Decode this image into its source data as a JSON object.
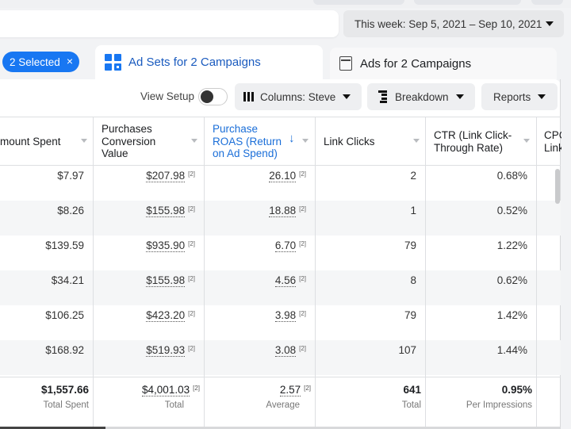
{
  "date_range": {
    "label": "This week: Sep 5, 2021 – Sep 10, 2021"
  },
  "selection": {
    "label": "2 Selected",
    "clear_icon": "×"
  },
  "tabs": [
    {
      "label": "Ad Sets for 2 Campaigns",
      "icon": "ad-sets-grid-icon",
      "active": true
    },
    {
      "label": "Ads for 2 Campaigns",
      "icon": "ad-window-icon",
      "active": false
    }
  ],
  "toolbar": {
    "view_setup_label": "View Setup",
    "view_setup_on": false,
    "columns_label": "Columns: Steve",
    "breakdown_label": "Breakdown",
    "reports_label": "Reports"
  },
  "table": {
    "columns": [
      {
        "label": "mount Spent",
        "full": "Amount Spent"
      },
      {
        "label": "Purchases Conversion Value"
      },
      {
        "label": "Purchase ROAS (Return on Ad Spend)",
        "sorted": "descending"
      },
      {
        "label": "Link Clicks"
      },
      {
        "label": "CTR (Link Click-Through Rate)"
      },
      {
        "label": "CPC Link"
      }
    ],
    "footnote_marker": "[2]",
    "rows": [
      {
        "amount_spent": "$7.97",
        "conv_value": "$207.98",
        "roas": "26.10",
        "link_clicks": "2",
        "ctr": "0.68%"
      },
      {
        "amount_spent": "$8.26",
        "conv_value": "$155.98",
        "roas": "18.88",
        "link_clicks": "1",
        "ctr": "0.52%"
      },
      {
        "amount_spent": "$139.59",
        "conv_value": "$935.90",
        "roas": "6.70",
        "link_clicks": "79",
        "ctr": "1.22%"
      },
      {
        "amount_spent": "$34.21",
        "conv_value": "$155.98",
        "roas": "4.56",
        "link_clicks": "8",
        "ctr": "0.62%"
      },
      {
        "amount_spent": "$106.25",
        "conv_value": "$423.20",
        "roas": "3.98",
        "link_clicks": "79",
        "ctr": "1.42%"
      },
      {
        "amount_spent": "$168.92",
        "conv_value": "$519.93",
        "roas": "3.08",
        "link_clicks": "107",
        "ctr": "1.44%"
      }
    ],
    "totals": {
      "amount_spent": {
        "value": "$1,557.66",
        "label": "Total Spent"
      },
      "conv_value": {
        "value": "$4,001.03",
        "label": "Total"
      },
      "roas": {
        "value": "2.57",
        "label": "Average"
      },
      "link_clicks": {
        "value": "641",
        "label": "Total"
      },
      "ctr": {
        "value": "0.95%",
        "label": "Per Impressions"
      }
    }
  },
  "colors": {
    "accent": "#1877f2",
    "active_header": "#1a6ed8"
  }
}
